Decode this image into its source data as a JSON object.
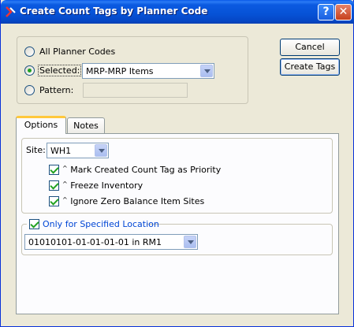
{
  "window": {
    "title": "Create Count Tags by Planner Code",
    "help_label": "?",
    "close_label": "✕"
  },
  "selection": {
    "all_label": "All Planner Codes",
    "selected_label": "Selected:",
    "selected_value": "MRP-MRP Items",
    "pattern_label": "Pattern:",
    "pattern_value": ""
  },
  "buttons": {
    "cancel_label": "Cancel",
    "create_label": "Create Tags"
  },
  "tabs": [
    {
      "label": "Options",
      "active": true
    },
    {
      "label": "Notes",
      "active": false
    }
  ],
  "options": {
    "site_label": "Site:",
    "site_value": "WH1",
    "checkboxes": [
      {
        "label": "Mark Created Count Tag as Priority",
        "checked": true
      },
      {
        "label": "Freeze Inventory",
        "checked": true
      },
      {
        "label": "Ignore Zero Balance Item Sites",
        "checked": true
      }
    ],
    "location_group_label": "Only for Specified Location",
    "location_checked": true,
    "location_value": "01010101-01-01-01-01 in RM1"
  }
}
